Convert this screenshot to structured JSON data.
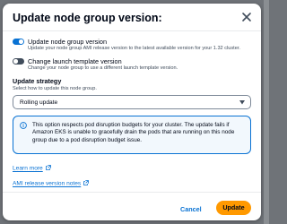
{
  "modal": {
    "title": "Update node group version:",
    "close_icon": "close-icon"
  },
  "options": [
    {
      "label": "Update node group version",
      "description": "Update your node group AMI release version to the latest available version for your 1.32 cluster.",
      "enabled": true
    },
    {
      "label": "Change launch template version",
      "description": "Change your node group to use a different launch template version.",
      "enabled": false
    }
  ],
  "strategy": {
    "label": "Update strategy",
    "description": "Select how to update this node group.",
    "selected": "Rolling update"
  },
  "alert": {
    "icon": "info-icon",
    "text": "This option respects pod disruption budgets for your cluster. The update fails if Amazon EKS is unable to gracefully drain the pods that are running on this node group due to a pod disruption budget issue."
  },
  "links": {
    "learn_more": "Learn more",
    "ami_notes": "AMI release version notes"
  },
  "footer": {
    "cancel": "Cancel",
    "update": "Update"
  },
  "colors": {
    "accent": "#0972d3",
    "primary_button": "#ff9900",
    "overlay": "#6f7378"
  }
}
